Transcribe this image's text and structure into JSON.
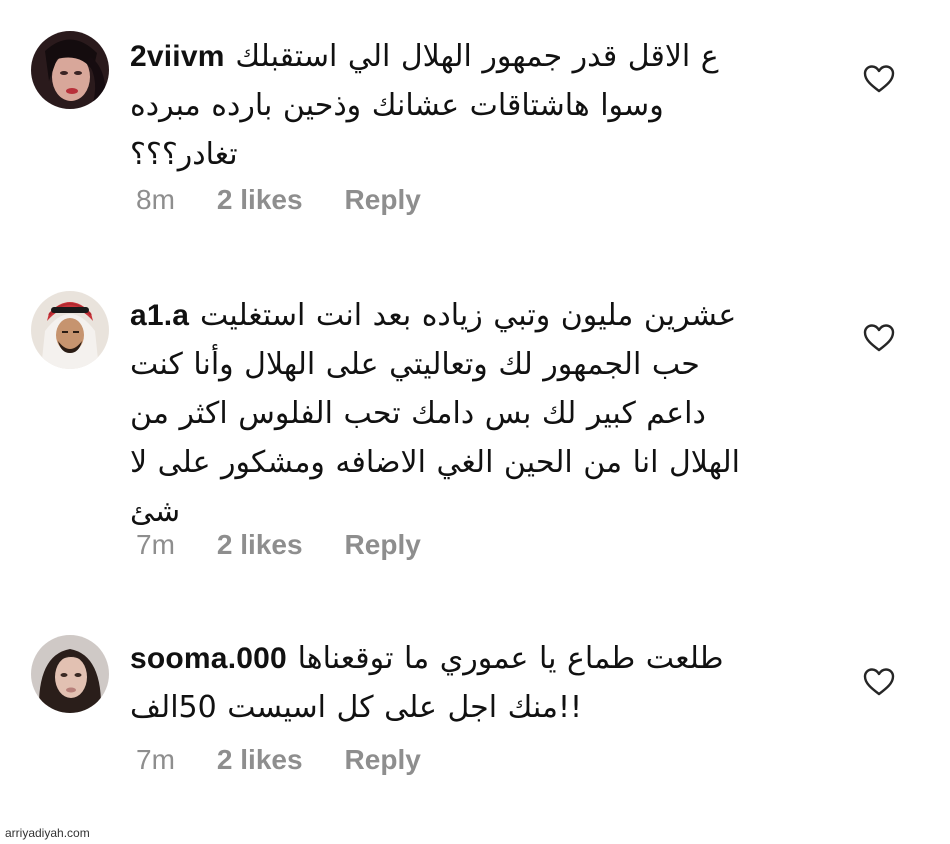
{
  "comments": [
    {
      "username": "2viivm",
      "first_line": "ع الاقل قدر جمهور الهلال الي استقبلك",
      "lines": [
        "وسوا هاشتاقات عشانك وذحين بارده مبرده",
        "تغادر؟؟؟"
      ],
      "time": "8m",
      "likes": "2 likes",
      "reply": "Reply"
    },
    {
      "username": "a1.a",
      "first_line": "عشرين مليون وتبي زياده بعد انت استغليت",
      "lines": [
        "حب الجمهور لك وتعاليتي على الهلال وأنا كنت",
        "داعم كبير لك بس دامك تحب الفلوس اكثر من",
        "الهلال انا من الحين الغي الاضافه ومشكور على لا",
        "شئ"
      ],
      "time": "7m",
      "likes": "2 likes",
      "reply": "Reply"
    },
    {
      "username": "sooma.000",
      "first_line": "طلعت طماع يا عموري ما توقعناها",
      "lines": [
        "!!منك اجل على كل اسيست 50الف"
      ],
      "time": "7m",
      "likes": "2 likes",
      "reply": "Reply"
    }
  ],
  "icons": {
    "like": "heart-outline-icon",
    "avatar": "user-avatar"
  },
  "colors": {
    "meta": "#8e8e8e",
    "text": "#111111",
    "heart": "#262626"
  },
  "watermark": "arriyadiyah.com"
}
